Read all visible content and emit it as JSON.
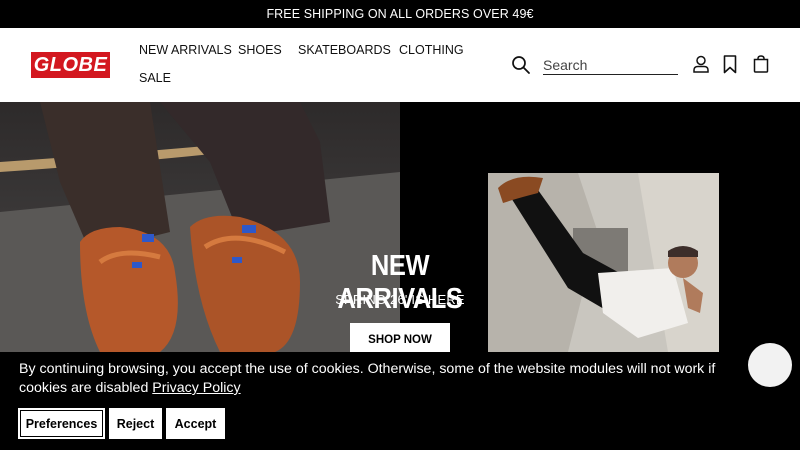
{
  "announcement": {
    "text": "FREE SHIPPING ON ALL ORDERS OVER 49€"
  },
  "header": {
    "logo_text": "GLOBE",
    "nav": [
      {
        "label": "NEW ARRIVALS"
      },
      {
        "label": "SHOES"
      },
      {
        "label": "SKATEBOARDS"
      },
      {
        "label": "CLOTHING"
      },
      {
        "label": "SALE"
      }
    ],
    "search": {
      "placeholder": "Search",
      "value": ""
    },
    "icons": [
      "search-icon",
      "account-icon",
      "wishlist-bookmark-icon",
      "cart-icon"
    ]
  },
  "hero": {
    "title": "NEW ARRIVALS",
    "subtitle": "SPRING 26' IS HERE",
    "cta_label": "SHOP NOW"
  },
  "cookie_banner": {
    "text": "By continuing browsing, you accept the use of cookies. Otherwise, some of the website modules will not work if cookies are disabled",
    "link_label": "Privacy Policy",
    "buttons": {
      "preferences": "Preferences",
      "reject": "Reject",
      "accept": "Accept"
    }
  },
  "colors": {
    "brand_red": "#d3171f",
    "dark": "#000000",
    "light": "#ffffff"
  }
}
